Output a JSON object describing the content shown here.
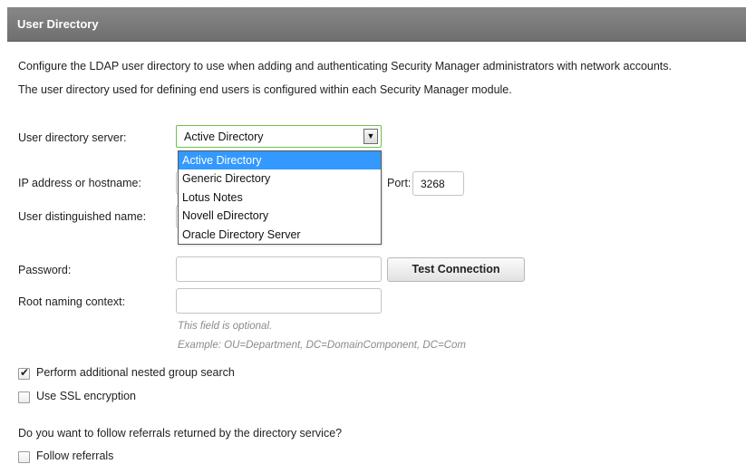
{
  "header": {
    "title": "User Directory"
  },
  "description": {
    "line1": "Configure the LDAP user directory to use when adding and authenticating Security Manager administrators with network accounts.",
    "line2": "The user directory used for defining end users is configured within each Security Manager module."
  },
  "fields": {
    "server_label": "User directory server:",
    "server_value": "Active Directory",
    "ip_label": "IP address or hostname:",
    "port_label": "Port:",
    "port_value": "3268",
    "dn_label": "User distinguished name:",
    "password_label": "Password:",
    "password_value": "",
    "root_label": "Root naming context:",
    "root_value": ""
  },
  "dropdown": {
    "options": [
      "Active Directory",
      "Generic Directory",
      "Lotus Notes",
      "Novell eDirectory",
      "Oracle Directory Server"
    ],
    "selected_index": 0
  },
  "test_button": "Test Connection",
  "hint": {
    "line1": "This field is optional.",
    "line2": "Example: OU=Department, DC=DomainComponent, DC=Com"
  },
  "checkboxes": {
    "nested": {
      "label": "Perform additional nested group search",
      "checked": true
    },
    "ssl": {
      "label": "Use SSL encryption",
      "checked": false
    }
  },
  "referrals": {
    "question": "Do you want to follow referrals returned by the directory service?",
    "follow": {
      "label": "Follow referrals",
      "checked": false
    }
  },
  "colors": {
    "header_bg": "#7b7b7b",
    "select_border": "#6cc04a",
    "selected_option": "#3399ff"
  }
}
